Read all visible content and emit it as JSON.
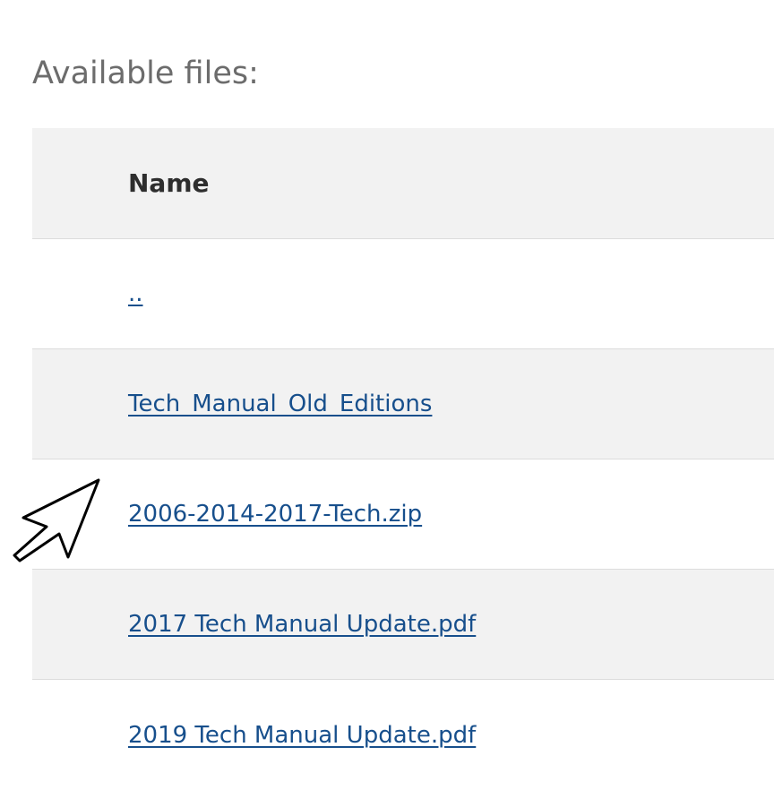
{
  "section": {
    "title": "Available files:"
  },
  "table": {
    "column_header": "Name",
    "rows": [
      {
        "label": ".."
      },
      {
        "label": "Tech_Manual_Old_Editions"
      },
      {
        "label": "2006-2014-2017-Tech.zip"
      },
      {
        "label": "2017 Tech Manual Update.pdf"
      },
      {
        "label": "2019 Tech Manual Update.pdf"
      }
    ]
  },
  "colors": {
    "link": "#174f8c",
    "row_shade": "#f2f2f2",
    "title_text": "#6c6c6c"
  },
  "icons": {
    "cursor": "mouse-pointer-icon"
  }
}
